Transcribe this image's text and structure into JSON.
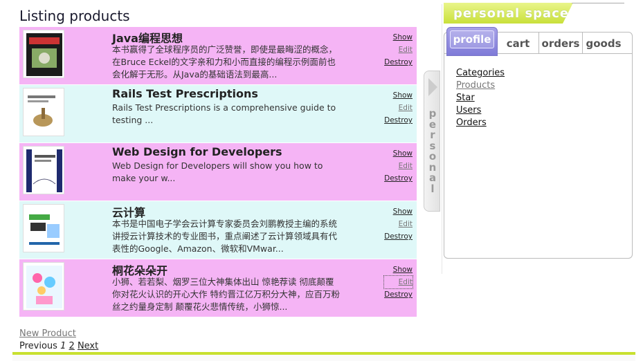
{
  "page_title": "Listing products",
  "products": [
    {
      "title": "Java编程思想",
      "description": "本书赢得了全球程序员的广泛赞誉，即使是最晦涩的概念，在Bruce Eckel的文字亲和力和小而直接的编程示例面前也会化解于无形。从Java的基础语法到最高...",
      "bg": "pink"
    },
    {
      "title": "Rails Test Prescriptions",
      "description": "Rails Test Prescriptions is a comprehensive guide to testing ...",
      "bg": "cyan"
    },
    {
      "title": "Web Design for Developers",
      "description": "Web Design for Developers will show you how to make your w...",
      "bg": "pink"
    },
    {
      "title": "云计算",
      "description": "本书是中国电子学会云计算专家委员会刘鹏教授主编的系统讲授云计算技术的专业图书，重点阐述了云计算领域具有代表性的Google、Amazon、微软和VMwar...",
      "bg": "cyan"
    },
    {
      "title": "桐花朵朵开",
      "description": "小狮、若若梨、烟罗三位大神集体出山 惊艳荐读 彻底颠覆你对花火认识的开心大作 特约晋江亿万积分大神，应百万粉丝之约量身定制 颠覆花火悲情传统，小狮惊...",
      "bg": "pink"
    }
  ],
  "actions": {
    "show": "Show",
    "edit": "Edit",
    "destroy": "Destroy"
  },
  "new_product": "New Product",
  "pagination": {
    "previous": "Previous",
    "page1": "1",
    "page2": "2",
    "next": "Next"
  },
  "sidebar": {
    "header": "personal space",
    "handle_label": "personal",
    "tabs": [
      "profile",
      "cart",
      "orders",
      "goods"
    ],
    "links": [
      "Categories",
      "Products",
      "Star",
      "Users",
      "Orders"
    ]
  },
  "colors": {
    "pink_row": "#f5b4f5",
    "cyan_row": "#dff8f8",
    "accent": "#c8e030",
    "active_tab": "#8f8ae0"
  }
}
